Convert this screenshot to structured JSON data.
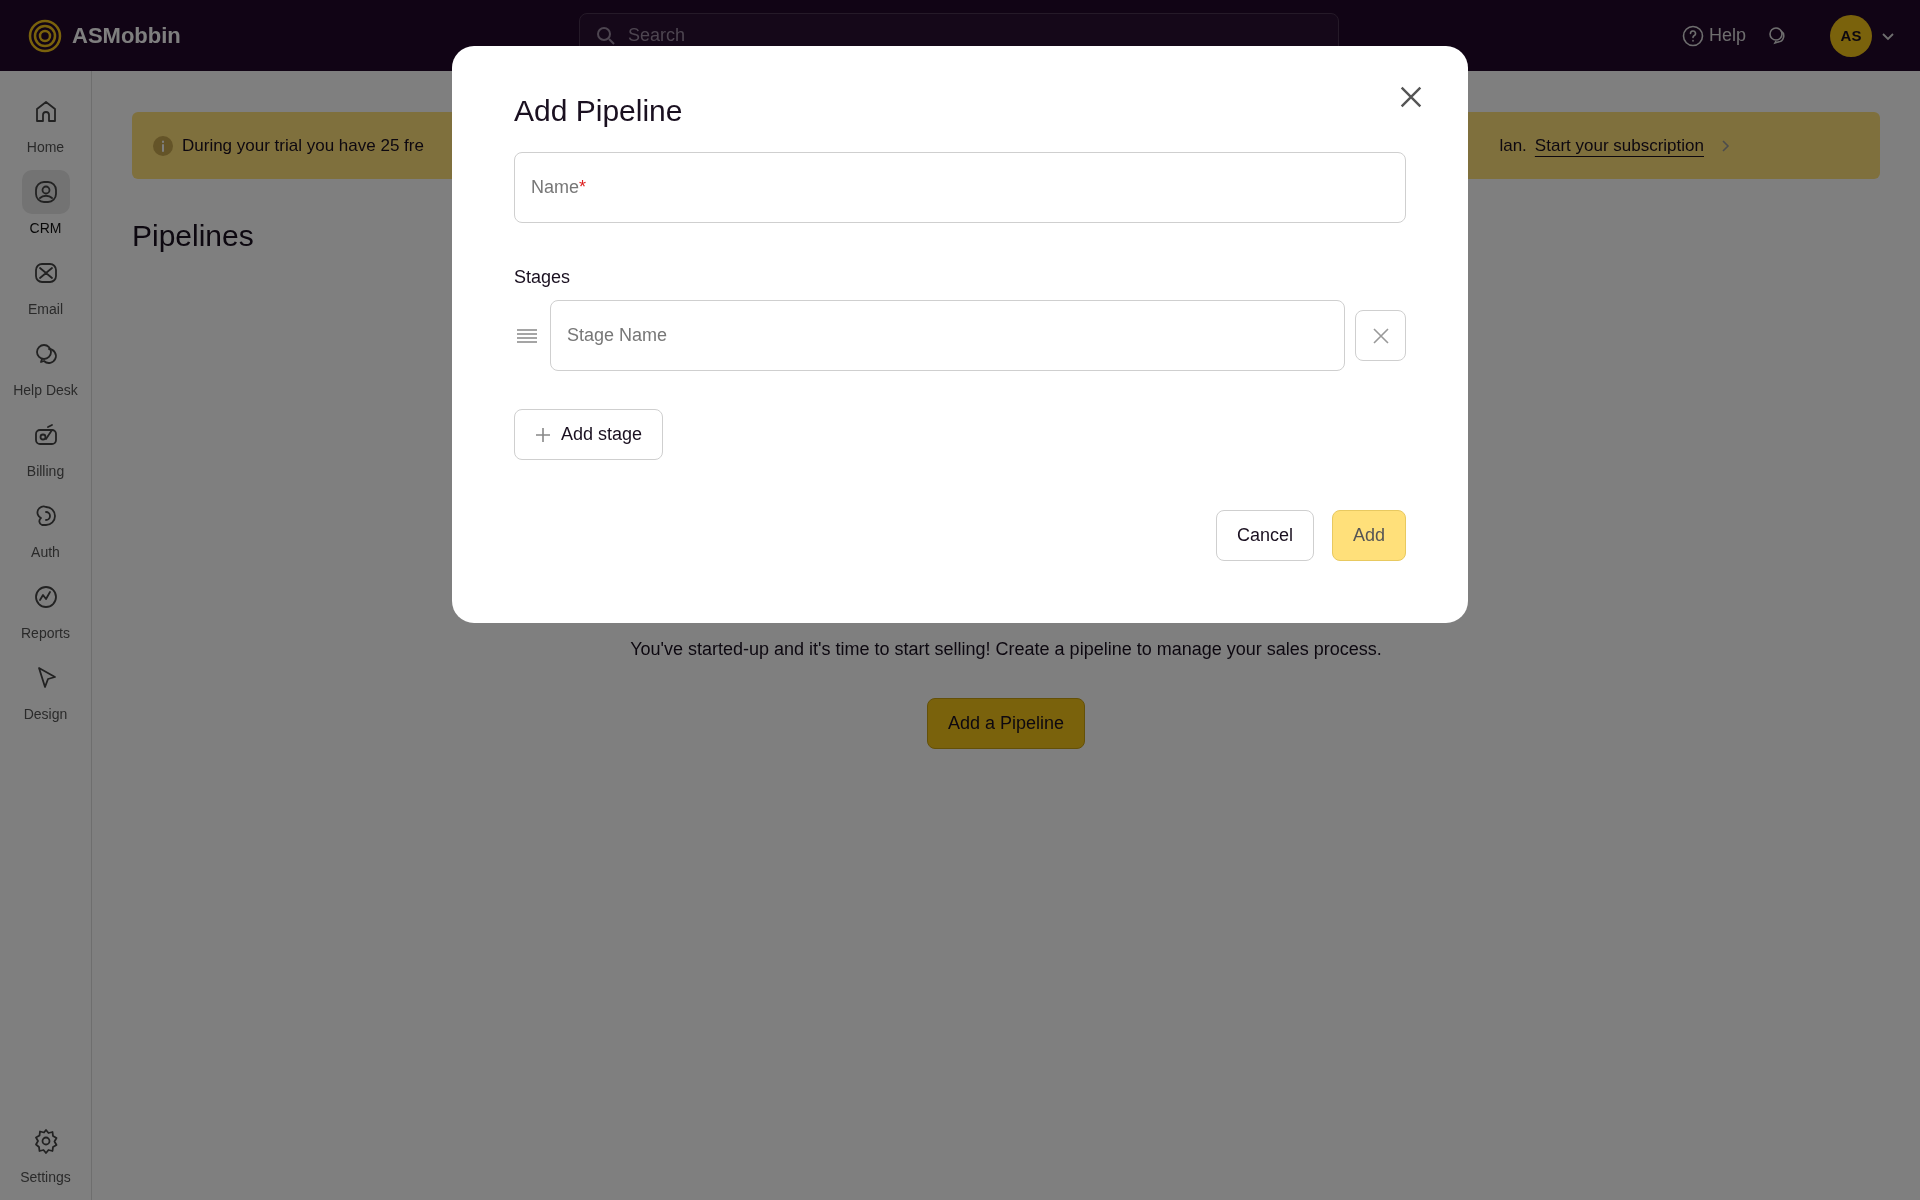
{
  "app": {
    "name": "ASMobbin"
  },
  "search": {
    "placeholder": "Search"
  },
  "header": {
    "help": "Help",
    "avatar": "AS"
  },
  "sidebar": {
    "items": [
      {
        "label": "Home",
        "selected": false
      },
      {
        "label": "CRM",
        "selected": true
      },
      {
        "label": "Email",
        "selected": false
      },
      {
        "label": "Help Desk",
        "selected": false
      },
      {
        "label": "Billing",
        "selected": false
      },
      {
        "label": "Auth",
        "selected": false
      },
      {
        "label": "Reports",
        "selected": false
      },
      {
        "label": "Design",
        "selected": false
      }
    ],
    "footer": {
      "label": "Settings"
    }
  },
  "banner": {
    "text_start": "During your trial you have 25 fre",
    "text_end": "lan.",
    "link": "Start your subscription"
  },
  "page": {
    "title": "Pipelines",
    "message": "You've started-up and it's time to start selling! Create a pipeline to manage your sales process.",
    "button": "Add a Pipeline"
  },
  "dialog": {
    "title": "Add Pipeline",
    "name_field": {
      "placeholder": "Name",
      "required_mark": "*"
    },
    "stages_label": "Stages",
    "stages": [
      {
        "placeholder": "Stage Name"
      }
    ],
    "add_stage": "Add stage",
    "buttons": [
      {
        "label": "Cancel",
        "kind": "secondary"
      },
      {
        "label": "Add",
        "kind": "primary"
      }
    ]
  }
}
